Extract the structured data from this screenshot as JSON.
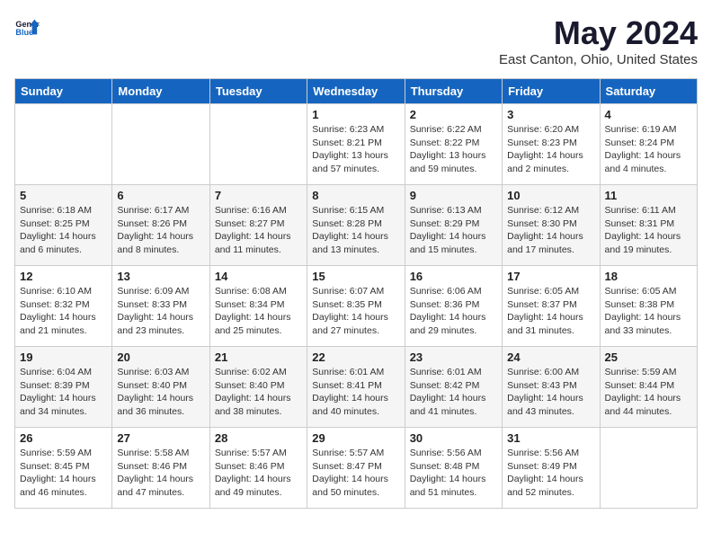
{
  "header": {
    "logo_general": "General",
    "logo_blue": "Blue",
    "title": "May 2024",
    "subtitle": "East Canton, Ohio, United States"
  },
  "columns": [
    "Sunday",
    "Monday",
    "Tuesday",
    "Wednesday",
    "Thursday",
    "Friday",
    "Saturday"
  ],
  "weeks": [
    [
      {
        "day": "",
        "sunrise": "",
        "sunset": "",
        "daylight": ""
      },
      {
        "day": "",
        "sunrise": "",
        "sunset": "",
        "daylight": ""
      },
      {
        "day": "",
        "sunrise": "",
        "sunset": "",
        "daylight": ""
      },
      {
        "day": "1",
        "sunrise": "Sunrise: 6:23 AM",
        "sunset": "Sunset: 8:21 PM",
        "daylight": "Daylight: 13 hours and 57 minutes."
      },
      {
        "day": "2",
        "sunrise": "Sunrise: 6:22 AM",
        "sunset": "Sunset: 8:22 PM",
        "daylight": "Daylight: 13 hours and 59 minutes."
      },
      {
        "day": "3",
        "sunrise": "Sunrise: 6:20 AM",
        "sunset": "Sunset: 8:23 PM",
        "daylight": "Daylight: 14 hours and 2 minutes."
      },
      {
        "day": "4",
        "sunrise": "Sunrise: 6:19 AM",
        "sunset": "Sunset: 8:24 PM",
        "daylight": "Daylight: 14 hours and 4 minutes."
      }
    ],
    [
      {
        "day": "5",
        "sunrise": "Sunrise: 6:18 AM",
        "sunset": "Sunset: 8:25 PM",
        "daylight": "Daylight: 14 hours and 6 minutes."
      },
      {
        "day": "6",
        "sunrise": "Sunrise: 6:17 AM",
        "sunset": "Sunset: 8:26 PM",
        "daylight": "Daylight: 14 hours and 8 minutes."
      },
      {
        "day": "7",
        "sunrise": "Sunrise: 6:16 AM",
        "sunset": "Sunset: 8:27 PM",
        "daylight": "Daylight: 14 hours and 11 minutes."
      },
      {
        "day": "8",
        "sunrise": "Sunrise: 6:15 AM",
        "sunset": "Sunset: 8:28 PM",
        "daylight": "Daylight: 14 hours and 13 minutes."
      },
      {
        "day": "9",
        "sunrise": "Sunrise: 6:13 AM",
        "sunset": "Sunset: 8:29 PM",
        "daylight": "Daylight: 14 hours and 15 minutes."
      },
      {
        "day": "10",
        "sunrise": "Sunrise: 6:12 AM",
        "sunset": "Sunset: 8:30 PM",
        "daylight": "Daylight: 14 hours and 17 minutes."
      },
      {
        "day": "11",
        "sunrise": "Sunrise: 6:11 AM",
        "sunset": "Sunset: 8:31 PM",
        "daylight": "Daylight: 14 hours and 19 minutes."
      }
    ],
    [
      {
        "day": "12",
        "sunrise": "Sunrise: 6:10 AM",
        "sunset": "Sunset: 8:32 PM",
        "daylight": "Daylight: 14 hours and 21 minutes."
      },
      {
        "day": "13",
        "sunrise": "Sunrise: 6:09 AM",
        "sunset": "Sunset: 8:33 PM",
        "daylight": "Daylight: 14 hours and 23 minutes."
      },
      {
        "day": "14",
        "sunrise": "Sunrise: 6:08 AM",
        "sunset": "Sunset: 8:34 PM",
        "daylight": "Daylight: 14 hours and 25 minutes."
      },
      {
        "day": "15",
        "sunrise": "Sunrise: 6:07 AM",
        "sunset": "Sunset: 8:35 PM",
        "daylight": "Daylight: 14 hours and 27 minutes."
      },
      {
        "day": "16",
        "sunrise": "Sunrise: 6:06 AM",
        "sunset": "Sunset: 8:36 PM",
        "daylight": "Daylight: 14 hours and 29 minutes."
      },
      {
        "day": "17",
        "sunrise": "Sunrise: 6:05 AM",
        "sunset": "Sunset: 8:37 PM",
        "daylight": "Daylight: 14 hours and 31 minutes."
      },
      {
        "day": "18",
        "sunrise": "Sunrise: 6:05 AM",
        "sunset": "Sunset: 8:38 PM",
        "daylight": "Daylight: 14 hours and 33 minutes."
      }
    ],
    [
      {
        "day": "19",
        "sunrise": "Sunrise: 6:04 AM",
        "sunset": "Sunset: 8:39 PM",
        "daylight": "Daylight: 14 hours and 34 minutes."
      },
      {
        "day": "20",
        "sunrise": "Sunrise: 6:03 AM",
        "sunset": "Sunset: 8:40 PM",
        "daylight": "Daylight: 14 hours and 36 minutes."
      },
      {
        "day": "21",
        "sunrise": "Sunrise: 6:02 AM",
        "sunset": "Sunset: 8:40 PM",
        "daylight": "Daylight: 14 hours and 38 minutes."
      },
      {
        "day": "22",
        "sunrise": "Sunrise: 6:01 AM",
        "sunset": "Sunset: 8:41 PM",
        "daylight": "Daylight: 14 hours and 40 minutes."
      },
      {
        "day": "23",
        "sunrise": "Sunrise: 6:01 AM",
        "sunset": "Sunset: 8:42 PM",
        "daylight": "Daylight: 14 hours and 41 minutes."
      },
      {
        "day": "24",
        "sunrise": "Sunrise: 6:00 AM",
        "sunset": "Sunset: 8:43 PM",
        "daylight": "Daylight: 14 hours and 43 minutes."
      },
      {
        "day": "25",
        "sunrise": "Sunrise: 5:59 AM",
        "sunset": "Sunset: 8:44 PM",
        "daylight": "Daylight: 14 hours and 44 minutes."
      }
    ],
    [
      {
        "day": "26",
        "sunrise": "Sunrise: 5:59 AM",
        "sunset": "Sunset: 8:45 PM",
        "daylight": "Daylight: 14 hours and 46 minutes."
      },
      {
        "day": "27",
        "sunrise": "Sunrise: 5:58 AM",
        "sunset": "Sunset: 8:46 PM",
        "daylight": "Daylight: 14 hours and 47 minutes."
      },
      {
        "day": "28",
        "sunrise": "Sunrise: 5:57 AM",
        "sunset": "Sunset: 8:46 PM",
        "daylight": "Daylight: 14 hours and 49 minutes."
      },
      {
        "day": "29",
        "sunrise": "Sunrise: 5:57 AM",
        "sunset": "Sunset: 8:47 PM",
        "daylight": "Daylight: 14 hours and 50 minutes."
      },
      {
        "day": "30",
        "sunrise": "Sunrise: 5:56 AM",
        "sunset": "Sunset: 8:48 PM",
        "daylight": "Daylight: 14 hours and 51 minutes."
      },
      {
        "day": "31",
        "sunrise": "Sunrise: 5:56 AM",
        "sunset": "Sunset: 8:49 PM",
        "daylight": "Daylight: 14 hours and 52 minutes."
      },
      {
        "day": "",
        "sunrise": "",
        "sunset": "",
        "daylight": ""
      }
    ]
  ]
}
